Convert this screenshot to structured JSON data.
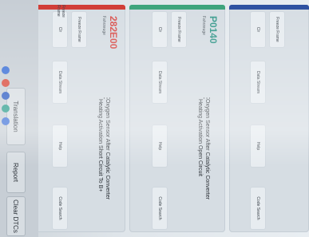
{
  "cards": [
    {
      "accent": "#d03a34",
      "code": "282E00",
      "code_sub": "Fahrzeuge",
      "title": "Oxygen Sensor After Catalytic Converter Heating Activation Short Circuit To B+",
      "buttons": [
        "Freeze Frame",
        "Data Stream",
        "Help",
        "Code Search"
      ],
      "left_button": "Clr"
    },
    {
      "accent": "#3aa37a",
      "code": "P0140",
      "code_sub": "Fahrzeuge",
      "title": "Oxygen Sensor After Catalytic Converter Heating Activation Open Circuit",
      "buttons": [
        "Freeze Frame",
        "Data Stream",
        "Help",
        "Code Search"
      ],
      "left_button": "Clr"
    },
    {
      "accent": "#2b4fa0",
      "code": "",
      "code_sub": "",
      "title": "",
      "buttons": [
        "Freeze Frame",
        "Data Stream",
        "Help",
        "Code Search"
      ],
      "left_button": "Clr"
    }
  ],
  "toolbar": {
    "translation": "Translation",
    "report": "Report",
    "clear_dtcs": "Clear DTCs"
  },
  "app_icons": [
    "blue-circle-icon",
    "red-circle-icon",
    "blue-circle-icon",
    "teal-circle-icon",
    "blue-circle-icon"
  ]
}
